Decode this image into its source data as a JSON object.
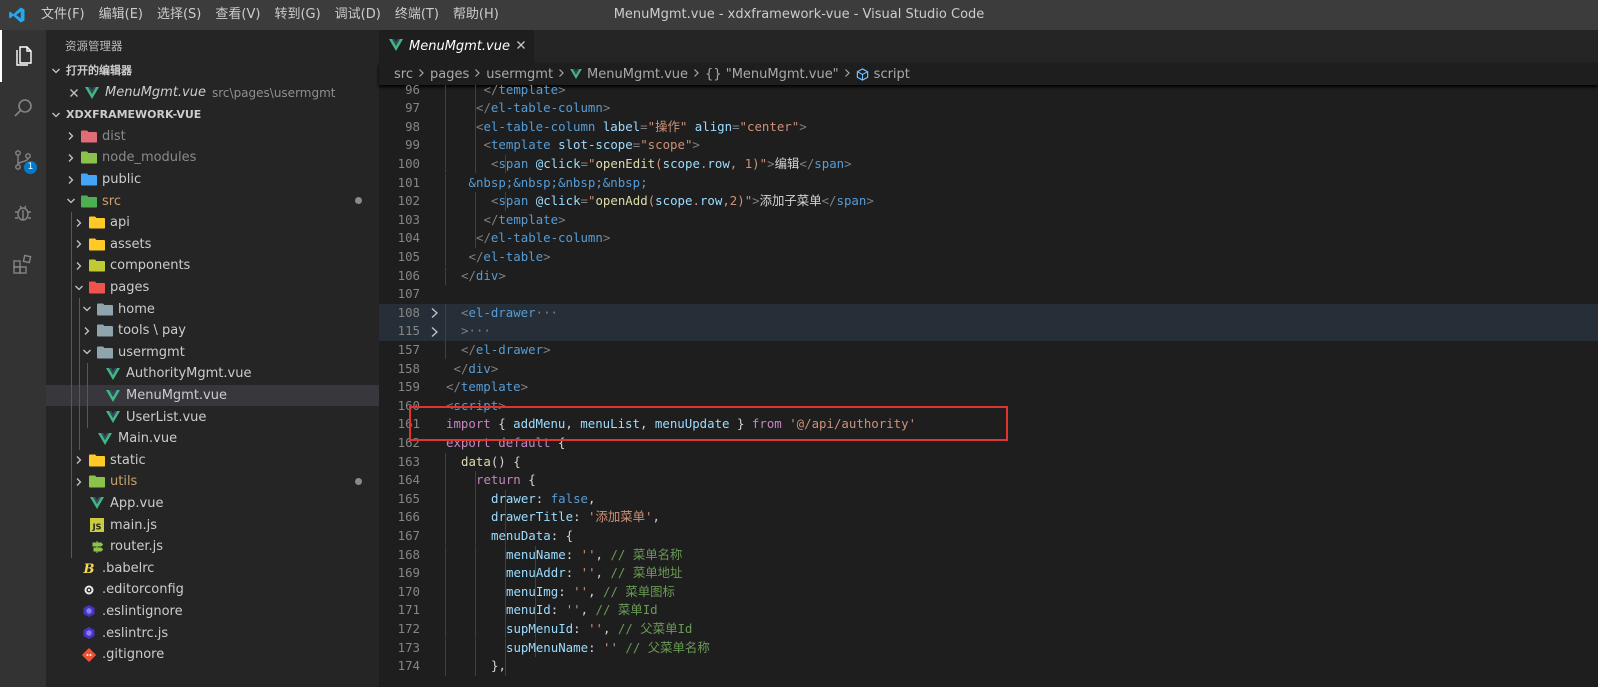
{
  "window": {
    "title": "MenuMgmt.vue - xdxframework-vue - Visual Studio Code"
  },
  "menu": [
    "文件(F)",
    "编辑(E)",
    "选择(S)",
    "查看(V)",
    "转到(G)",
    "调试(D)",
    "终端(T)",
    "帮助(H)"
  ],
  "activity": {
    "scm_badge": "1"
  },
  "explorer": {
    "title": "资源管理器",
    "open_editors": {
      "header": "打开的编辑器",
      "items": [
        {
          "name": "MenuMgmt.vue",
          "path": "src\\pages\\usermgmt"
        }
      ]
    },
    "project": {
      "header": "XDXFRAMEWORK-VUE"
    },
    "tree": [
      {
        "name": "dist",
        "depth": 0,
        "type": "folder",
        "icon": "folder-dist-icon",
        "color": "#e06c75",
        "dim": true
      },
      {
        "name": "node_modules",
        "depth": 0,
        "type": "folder",
        "icon": "folder-node-icon",
        "color": "#8bc34a",
        "dim": true
      },
      {
        "name": "public",
        "depth": 0,
        "type": "folder",
        "icon": "folder-public-icon",
        "color": "#42a5f5"
      },
      {
        "name": "src",
        "depth": 0,
        "type": "folder",
        "open": true,
        "icon": "folder-src-icon",
        "color": "#4caf50",
        "modified": true
      },
      {
        "name": "api",
        "depth": 1,
        "type": "folder",
        "icon": "folder-api-icon",
        "color": "#ffca28"
      },
      {
        "name": "assets",
        "depth": 1,
        "type": "folder",
        "icon": "folder-assets-icon",
        "color": "#ffca28"
      },
      {
        "name": "components",
        "depth": 1,
        "type": "folder",
        "icon": "folder-components-icon",
        "color": "#c0ca33"
      },
      {
        "name": "pages",
        "depth": 1,
        "type": "folder",
        "open": true,
        "icon": "folder-pages-icon",
        "color": "#ef5350"
      },
      {
        "name": "home",
        "depth": 2,
        "type": "folder",
        "open": true,
        "icon": "folder-home-icon",
        "color": "#90a4ae"
      },
      {
        "name": "tools \\ pay",
        "depth": 2,
        "type": "folder",
        "icon": "folder-tools-icon",
        "color": "#90a4ae"
      },
      {
        "name": "usermgmt",
        "depth": 2,
        "type": "folder",
        "open": true,
        "icon": "folder-usermgmt-icon",
        "color": "#90a4ae"
      },
      {
        "name": "AuthorityMgmt.vue",
        "depth": 3,
        "type": "vue",
        "icon": "vue-icon"
      },
      {
        "name": "MenuMgmt.vue",
        "depth": 3,
        "type": "vue",
        "icon": "vue-icon",
        "selected": true
      },
      {
        "name": "UserList.vue",
        "depth": 3,
        "type": "vue",
        "icon": "vue-icon"
      },
      {
        "name": "Main.vue",
        "depth": 2,
        "type": "vue",
        "icon": "vue-icon"
      },
      {
        "name": "static",
        "depth": 1,
        "type": "folder",
        "icon": "folder-static-icon",
        "color": "#ffca28"
      },
      {
        "name": "utils",
        "depth": 1,
        "type": "folder",
        "icon": "folder-utils-icon",
        "color": "#8bc34a",
        "modified": true
      },
      {
        "name": "App.vue",
        "depth": 1,
        "type": "vue",
        "icon": "vue-icon"
      },
      {
        "name": "main.js",
        "depth": 1,
        "type": "js",
        "icon": "js-file-icon"
      },
      {
        "name": "router.js",
        "depth": 1,
        "type": "router",
        "icon": "router-file-icon"
      },
      {
        "name": ".babelrc",
        "depth": 0,
        "type": "babel",
        "icon": "babel-icon"
      },
      {
        "name": ".editorconfig",
        "depth": 0,
        "type": "config",
        "icon": "editorconfig-icon"
      },
      {
        "name": ".eslintignore",
        "depth": 0,
        "type": "eslint",
        "icon": "eslint-icon"
      },
      {
        "name": ".eslintrc.js",
        "depth": 0,
        "type": "eslint",
        "icon": "eslint-icon"
      },
      {
        "name": ".gitignore",
        "depth": 0,
        "type": "git",
        "icon": "git-icon"
      }
    ]
  },
  "editor": {
    "tab": {
      "label": "MenuMgmt.vue"
    },
    "breadcrumb": [
      "src",
      "pages",
      "usermgmt",
      "MenuMgmt.vue",
      "{} \"MenuMgmt.vue\"",
      "script"
    ],
    "lines": [
      {
        "n": "96",
        "ind": 5,
        "t": [
          [
            "</",
            "t-pun"
          ],
          [
            "template",
            "t-tag"
          ],
          [
            ">",
            "t-pun"
          ]
        ]
      },
      {
        "n": "97",
        "ind": 4,
        "t": [
          [
            "</",
            "t-pun"
          ],
          [
            "el-table-column",
            "t-tag"
          ],
          [
            ">",
            "t-pun"
          ]
        ]
      },
      {
        "n": "98",
        "ind": 4,
        "t": [
          [
            "<",
            "t-pun"
          ],
          [
            "el-table-column",
            "t-tag"
          ],
          [
            " label",
            "t-att"
          ],
          [
            "=",
            "t-pun"
          ],
          [
            "\"操作\"",
            "t-str"
          ],
          [
            " align",
            "t-att"
          ],
          [
            "=",
            "t-pun"
          ],
          [
            "\"center\"",
            "t-str"
          ],
          [
            ">",
            "t-pun"
          ]
        ]
      },
      {
        "n": "99",
        "ind": 5,
        "t": [
          [
            "<",
            "t-pun"
          ],
          [
            "template",
            "t-tag"
          ],
          [
            " slot-scope",
            "t-att"
          ],
          [
            "=",
            "t-pun"
          ],
          [
            "\"scope\"",
            "t-str"
          ],
          [
            ">",
            "t-pun"
          ]
        ]
      },
      {
        "n": "100",
        "ind": 6,
        "t": [
          [
            "<",
            "t-pun"
          ],
          [
            "span",
            "t-tag"
          ],
          [
            " @click",
            "t-att"
          ],
          [
            "=",
            "t-pun"
          ],
          [
            "\"",
            "t-str"
          ],
          [
            "openEdit",
            "t-fn"
          ],
          [
            "(",
            "t-str"
          ],
          [
            "scope",
            "t-var"
          ],
          [
            ".",
            "t-str"
          ],
          [
            "row",
            "t-var"
          ],
          [
            ", 1)\"",
            "t-str"
          ],
          [
            ">",
            "t-pun"
          ],
          [
            "编辑",
            "t-txt"
          ],
          [
            "</",
            "t-pun"
          ],
          [
            "span",
            "t-tag"
          ],
          [
            ">",
            "t-pun"
          ]
        ]
      },
      {
        "n": "101",
        "ind": 3,
        "t": [
          [
            "&nbsp;&nbsp;&nbsp;&nbsp;",
            "t-kb"
          ]
        ]
      },
      {
        "n": "102",
        "ind": 6,
        "t": [
          [
            "<",
            "t-pun"
          ],
          [
            "span",
            "t-tag"
          ],
          [
            " @click",
            "t-att"
          ],
          [
            "=",
            "t-pun"
          ],
          [
            "\"",
            "t-str"
          ],
          [
            "openAdd",
            "t-fn"
          ],
          [
            "(",
            "t-str"
          ],
          [
            "scope",
            "t-var"
          ],
          [
            ".",
            "t-str"
          ],
          [
            "row",
            "t-var"
          ],
          [
            ",2)\"",
            "t-str"
          ],
          [
            ">",
            "t-pun"
          ],
          [
            "添加子菜单",
            "t-txt"
          ],
          [
            "</",
            "t-pun"
          ],
          [
            "span",
            "t-tag"
          ],
          [
            ">",
            "t-pun"
          ]
        ]
      },
      {
        "n": "103",
        "ind": 5,
        "t": [
          [
            "</",
            "t-pun"
          ],
          [
            "template",
            "t-tag"
          ],
          [
            ">",
            "t-pun"
          ]
        ]
      },
      {
        "n": "104",
        "ind": 4,
        "t": [
          [
            "</",
            "t-pun"
          ],
          [
            "el-table-column",
            "t-tag"
          ],
          [
            ">",
            "t-pun"
          ]
        ]
      },
      {
        "n": "105",
        "ind": 3,
        "t": [
          [
            "</",
            "t-pun"
          ],
          [
            "el-table",
            "t-tag"
          ],
          [
            ">",
            "t-pun"
          ]
        ]
      },
      {
        "n": "106",
        "ind": 2,
        "t": [
          [
            "</",
            "t-pun"
          ],
          [
            "div",
            "t-tag"
          ],
          [
            ">",
            "t-pun"
          ]
        ]
      },
      {
        "n": "107",
        "ind": 0,
        "t": []
      },
      {
        "n": "108",
        "ind": 2,
        "fold": true,
        "hl": true,
        "t": [
          [
            "<",
            "t-pun"
          ],
          [
            "el-drawer",
            "t-tag"
          ],
          [
            "···",
            "t-pun"
          ]
        ]
      },
      {
        "n": "115",
        "ind": 2,
        "fold": true,
        "hl": true,
        "t": [
          [
            ">",
            "t-pun"
          ],
          [
            "···",
            "t-pun"
          ]
        ]
      },
      {
        "n": "157",
        "ind": 2,
        "t": [
          [
            "</",
            "t-pun"
          ],
          [
            "el-drawer",
            "t-tag"
          ],
          [
            ">",
            "t-pun"
          ]
        ]
      },
      {
        "n": "158",
        "ind": 1,
        "t": [
          [
            "</",
            "t-pun"
          ],
          [
            "div",
            "t-tag"
          ],
          [
            ">",
            "t-pun"
          ]
        ]
      },
      {
        "n": "159",
        "ind": 0,
        "t": [
          [
            "</",
            "t-pun"
          ],
          [
            "template",
            "t-tag"
          ],
          [
            ">",
            "t-pun"
          ]
        ]
      },
      {
        "n": "160",
        "ind": 0,
        "t": [
          [
            "<",
            "t-pun"
          ],
          [
            "script",
            "t-tag"
          ],
          [
            ">",
            "t-pun"
          ]
        ]
      },
      {
        "n": "161",
        "ind": 0,
        "t": [
          [
            "import",
            "t-kw"
          ],
          [
            " { ",
            "t-txt"
          ],
          [
            "addMenu",
            "t-var"
          ],
          [
            ", ",
            "t-txt"
          ],
          [
            "menuList",
            "t-var"
          ],
          [
            ", ",
            "t-txt"
          ],
          [
            "menuUpdate",
            "t-var"
          ],
          [
            " } ",
            "t-txt"
          ],
          [
            "from",
            "t-kw"
          ],
          [
            " ",
            "t-txt"
          ],
          [
            "'@/api/authority'",
            "t-str"
          ]
        ]
      },
      {
        "n": "162",
        "ind": 0,
        "t": [
          [
            "export",
            "t-kw"
          ],
          [
            " ",
            "t-txt"
          ],
          [
            "default",
            "t-kw"
          ],
          [
            " {",
            "t-txt"
          ]
        ]
      },
      {
        "n": "163",
        "ind": 2,
        "t": [
          [
            "data",
            "t-fn"
          ],
          [
            "() {",
            "t-txt"
          ]
        ]
      },
      {
        "n": "164",
        "ind": 4,
        "t": [
          [
            "return",
            "t-kw"
          ],
          [
            " {",
            "t-txt"
          ]
        ]
      },
      {
        "n": "165",
        "ind": 6,
        "t": [
          [
            "drawer",
            "t-var"
          ],
          [
            ": ",
            "t-txt"
          ],
          [
            "false",
            "t-kb"
          ],
          [
            ",",
            "t-txt"
          ]
        ]
      },
      {
        "n": "166",
        "ind": 6,
        "t": [
          [
            "drawerTitle",
            "t-var"
          ],
          [
            ": ",
            "t-txt"
          ],
          [
            "'添加菜单'",
            "t-str"
          ],
          [
            ",",
            "t-txt"
          ]
        ]
      },
      {
        "n": "167",
        "ind": 6,
        "t": [
          [
            "menuData",
            "t-var"
          ],
          [
            ": {",
            "t-txt"
          ]
        ]
      },
      {
        "n": "168",
        "ind": 8,
        "t": [
          [
            "menuName",
            "t-var"
          ],
          [
            ": ",
            "t-txt"
          ],
          [
            "''",
            "t-str"
          ],
          [
            ", ",
            "t-txt"
          ],
          [
            "// 菜单名称",
            "t-cm"
          ]
        ]
      },
      {
        "n": "169",
        "ind": 8,
        "t": [
          [
            "menuAddr",
            "t-var"
          ],
          [
            ": ",
            "t-txt"
          ],
          [
            "''",
            "t-str"
          ],
          [
            ", ",
            "t-txt"
          ],
          [
            "// 菜单地址",
            "t-cm"
          ]
        ]
      },
      {
        "n": "170",
        "ind": 8,
        "t": [
          [
            "menuImg",
            "t-var"
          ],
          [
            ": ",
            "t-txt"
          ],
          [
            "''",
            "t-str"
          ],
          [
            ", ",
            "t-txt"
          ],
          [
            "// 菜单图标",
            "t-cm"
          ]
        ]
      },
      {
        "n": "171",
        "ind": 8,
        "t": [
          [
            "menuId",
            "t-var"
          ],
          [
            ": ",
            "t-txt"
          ],
          [
            "''",
            "t-str"
          ],
          [
            ", ",
            "t-txt"
          ],
          [
            "// 菜单Id",
            "t-cm"
          ]
        ]
      },
      {
        "n": "172",
        "ind": 8,
        "t": [
          [
            "supMenuId",
            "t-var"
          ],
          [
            ": ",
            "t-txt"
          ],
          [
            "''",
            "t-str"
          ],
          [
            ", ",
            "t-txt"
          ],
          [
            "// 父菜单Id",
            "t-cm"
          ]
        ]
      },
      {
        "n": "173",
        "ind": 8,
        "t": [
          [
            "supMenuName",
            "t-var"
          ],
          [
            ": ",
            "t-txt"
          ],
          [
            "''",
            "t-str"
          ],
          [
            " ",
            "t-txt"
          ],
          [
            "// 父菜单名称",
            "t-cm"
          ]
        ]
      },
      {
        "n": "174",
        "ind": 6,
        "t": [
          [
            "},",
            "t-txt"
          ]
        ]
      }
    ]
  }
}
